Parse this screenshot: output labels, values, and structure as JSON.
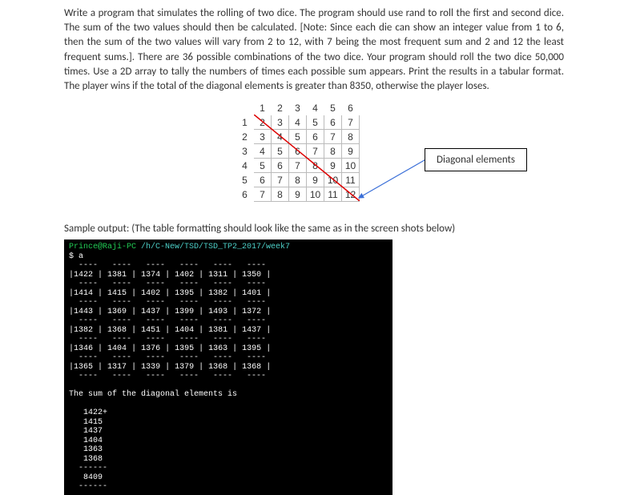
{
  "problem": {
    "text": "Write a program that simulates the rolling of two dice. The program should use rand to roll the first and second dice. The sum of the two values should then be calculated. [Note: Since each die can show an integer value from 1 to 6, then the sum of the two values will vary from 2 to 12, with 7 being the most frequent sum and 2 and 12 the least frequent sums.]. There are 36 possible combinations of the two dice. Your program should roll the two dice 50,000 times. Use a 2D array to tally the numbers of times each possible sum appears. Print the results in a tabular format. The player wins if the total of the diagonal elements is greater than 8350, otherwise the player loses."
  },
  "dice": {
    "col_headers": [
      "1",
      "2",
      "3",
      "4",
      "5",
      "6"
    ],
    "row_headers": [
      "1",
      "2",
      "3",
      "4",
      "5",
      "6"
    ],
    "grid": [
      [
        "2",
        "3",
        "4",
        "5",
        "6",
        "7"
      ],
      [
        "3",
        "4",
        "5",
        "6",
        "7",
        "8"
      ],
      [
        "4",
        "5",
        "6",
        "7",
        "8",
        "9"
      ],
      [
        "5",
        "6",
        "7",
        "8",
        "9",
        "10"
      ],
      [
        "6",
        "7",
        "8",
        "9",
        "10",
        "11"
      ],
      [
        "7",
        "8",
        "9",
        "10",
        "11",
        "12"
      ]
    ]
  },
  "label_box": "Diagonal elements",
  "sample_caption": "Sample output: (The table formatting should look like the same as in the screen shots below)",
  "terminal": {
    "prompt_user": "Prince@Raji-PC ",
    "prompt_path": "/h/C-New/TSD/TSD_TP2_2017/week7",
    "prompt_line2": "$ a",
    "rows": [
      [
        "1422",
        "1381",
        "1374",
        "1402",
        "1311",
        "1350"
      ],
      [
        "1414",
        "1415",
        "1402",
        "1395",
        "1382",
        "1401"
      ],
      [
        "1443",
        "1369",
        "1437",
        "1399",
        "1493",
        "1372"
      ],
      [
        "1382",
        "1368",
        "1451",
        "1404",
        "1381",
        "1437"
      ],
      [
        "1346",
        "1404",
        "1376",
        "1395",
        "1363",
        "1395"
      ],
      [
        "1365",
        "1317",
        "1339",
        "1379",
        "1368",
        "1368"
      ]
    ],
    "sum_label": "The sum of the diagonal elements is",
    "diag_values": [
      "1422+",
      "1415",
      "1437",
      "1404",
      "1363",
      "1368"
    ],
    "diag_dashes": "------",
    "total": "8409"
  },
  "chart_data": {
    "type": "table",
    "title": "Dice sum combinations (6x6)",
    "row_headers": [
      1,
      2,
      3,
      4,
      5,
      6
    ],
    "col_headers": [
      1,
      2,
      3,
      4,
      5,
      6
    ],
    "values": [
      [
        2,
        3,
        4,
        5,
        6,
        7
      ],
      [
        3,
        4,
        5,
        6,
        7,
        8
      ],
      [
        4,
        5,
        6,
        7,
        8,
        9
      ],
      [
        5,
        6,
        7,
        8,
        9,
        10
      ],
      [
        6,
        7,
        8,
        9,
        10,
        11
      ],
      [
        7,
        8,
        9,
        10,
        11,
        12
      ]
    ],
    "diagonal": [
      2,
      4,
      6,
      8,
      10,
      12
    ],
    "diagonal_label": "Diagonal elements",
    "sample_tally_6x6": [
      [
        1422,
        1381,
        1374,
        1402,
        1311,
        1350
      ],
      [
        1414,
        1415,
        1402,
        1395,
        1382,
        1401
      ],
      [
        1443,
        1369,
        1437,
        1399,
        1493,
        1372
      ],
      [
        1382,
        1368,
        1451,
        1404,
        1381,
        1437
      ],
      [
        1346,
        1404,
        1376,
        1395,
        1363,
        1395
      ],
      [
        1365,
        1317,
        1339,
        1379,
        1368,
        1368
      ]
    ],
    "sample_diagonal_values": [
      1422,
      1415,
      1437,
      1404,
      1363,
      1368
    ],
    "sample_diagonal_sum": 8409,
    "win_threshold": 8350
  }
}
